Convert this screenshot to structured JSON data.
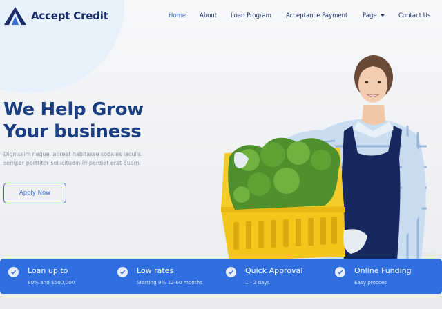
{
  "brand": {
    "name": "Accept Credit",
    "icon": "triangle-a-logo-icon"
  },
  "nav": {
    "items": [
      {
        "label": "Home",
        "active": true
      },
      {
        "label": "About"
      },
      {
        "label": "Loan Program"
      },
      {
        "label": "Acceptance Payment"
      },
      {
        "label": "Page",
        "has_dropdown": true
      },
      {
        "label": "Contact Us"
      }
    ]
  },
  "hero": {
    "headline_line1": "We Help Grow",
    "headline_line2": "Your business",
    "subtext": "Dignissim neque laoreet habitasse sodales iaculis semper porttitor sollicitudin imperdiet erat quam.",
    "cta_label": "Apply Now",
    "image_icon": "woman-holding-vegetable-crate-image"
  },
  "features": [
    {
      "title": "Loan up to",
      "subtitle": "80% and $500,000",
      "icon": "check-circle-icon"
    },
    {
      "title": "Low rates",
      "subtitle": "Starting 9% 12-60 months",
      "icon": "check-circle-icon"
    },
    {
      "title": "Quick Approval",
      "subtitle": "1 - 2 days",
      "icon": "check-circle-icon"
    },
    {
      "title": "Online Funding",
      "subtitle": "Easy procces",
      "icon": "check-circle-icon"
    }
  ],
  "colors": {
    "primary": "#2f6fe0",
    "nav_active": "#3d6fd6",
    "heading": "#1c3e82",
    "brand_text": "#1c2d6b",
    "crate_yellow": "#f3c61c",
    "apron_navy": "#16285e"
  }
}
